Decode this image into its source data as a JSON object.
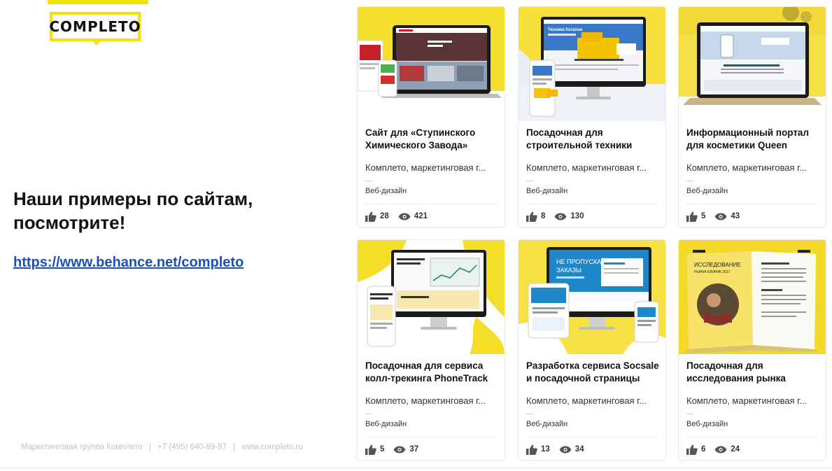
{
  "logo": {
    "text": "COMPLETO"
  },
  "headline": {
    "line1": "Наши примеры по сайтам,",
    "line2": "посмотрите!"
  },
  "link": "https://www.behance.net/completo",
  "footer": {
    "company": "Маркетинговая группа Комплето",
    "phone": "+7 (495) 640-89-97",
    "site": "www.completo.ru",
    "separator": "|"
  },
  "colors": {
    "brand_yellow": "#f4e200",
    "link_blue": "#1f4fb4"
  },
  "cards": [
    {
      "title1": "Сайт для «Ступинского",
      "title2": "Химического Завода»",
      "owner": "Комплето, маркетинговая г...",
      "field": "Веб-дизайн",
      "likes": "28",
      "views": "421"
    },
    {
      "title1": "Посадочная для",
      "title2": "строительной техники",
      "owner": "Комплето, маркетинговая г...",
      "field": "Веб-дизайн",
      "likes": "8",
      "views": "130"
    },
    {
      "title1": "Информационный портал",
      "title2": "для косметики Queen",
      "owner": "Комплето, маркетинговая г...",
      "field": "Веб-дизайн",
      "likes": "5",
      "views": "43"
    },
    {
      "title1": "Посадочная для сервиса",
      "title2": "колл-трекинга PhoneTrack",
      "owner": "Комплето, маркетинговая г...",
      "field": "Веб-дизайн",
      "likes": "5",
      "views": "37"
    },
    {
      "title1": "Разработка сервиса Socsale",
      "title2": "и посадочной страницы",
      "owner": "Комплето, маркетинговая г...",
      "field": "Веб-дизайн",
      "likes": "13",
      "views": "34"
    },
    {
      "title1": "Посадочная для",
      "title2": "исследования рынка",
      "owner": "Комплето, маркетинговая г...",
      "field": "Веб-дизайн",
      "likes": "6",
      "views": "24"
    }
  ],
  "mockups": {
    "card2_screen": "Техника Катапан",
    "card5_screen_line1": "НЕ ПРОПУСКАЙТЕ",
    "card5_screen_line2": "ЗАКАЗЫ",
    "card6_book_line1": "ИССЛЕДОВАНИЕ",
    "card6_book_line2": "РЫНКА КЛИНИК 2017"
  }
}
